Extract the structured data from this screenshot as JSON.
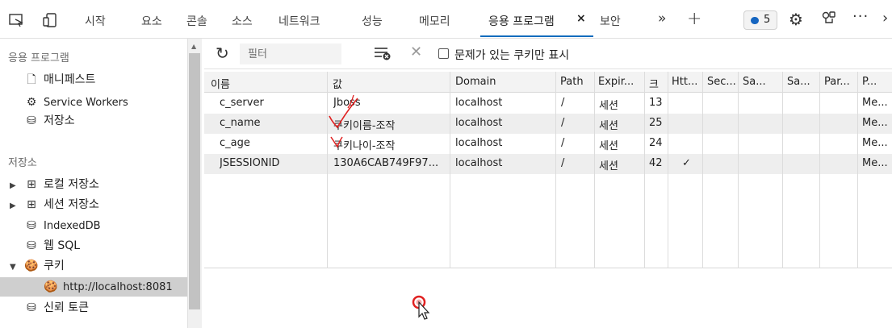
{
  "tabs": [
    {
      "label": "시작"
    },
    {
      "label": "요소"
    },
    {
      "label": "콘솔"
    },
    {
      "label": "소스"
    },
    {
      "label": "네트워크"
    },
    {
      "label": "성능"
    },
    {
      "label": "메모리"
    },
    {
      "label": "응용 프로그램"
    },
    {
      "label": "보안"
    }
  ],
  "topbar": {
    "active_tab_close": "×",
    "more_tabs": "»",
    "add_tab": "+",
    "issues_count": "5",
    "issues_color": "#1565c0",
    "settings_icon": "gear-icon",
    "connect_icon": "device-link-icon",
    "more_icon": "···",
    "chevron": "›"
  },
  "sidebar": {
    "app_heading": "응용 프로그램",
    "app_items": [
      {
        "icon": "manifest-icon",
        "label": "매니페스트"
      },
      {
        "icon": "gear-icon",
        "label": "Service Workers"
      },
      {
        "icon": "storage-icon",
        "label": "저장소"
      }
    ],
    "storage_heading": "저장소",
    "storage_items": [
      {
        "icon": "grid-icon",
        "label": "로컬 저장소"
      },
      {
        "icon": "grid-icon",
        "label": "세션 저장소"
      },
      {
        "icon": "database-icon",
        "label": "IndexedDB"
      },
      {
        "icon": "database-icon",
        "label": "웹 SQL"
      },
      {
        "icon": "cookie-icon",
        "label": "쿠키"
      },
      {
        "icon": "cookie-icon",
        "label": "http://localhost:8081"
      },
      {
        "icon": "database-icon",
        "label": "신뢰 토큰"
      }
    ]
  },
  "toolbar": {
    "filter_placeholder": "필터",
    "only_issues_label": "문제가 있는 쿠키만 표시"
  },
  "table": {
    "columns": [
      "이름",
      "값",
      "Domain",
      "Path",
      "Expir...",
      "크",
      "Htt...",
      "Sec...",
      "Sa...",
      "Sa...",
      "Par...",
      "P..."
    ],
    "rows": [
      {
        "name": "c_server",
        "value": "Jboss",
        "domain": "localhost",
        "path": "/",
        "expires": "세션",
        "size": "13",
        "httponly": "",
        "priority": "Me..."
      },
      {
        "name": "c_name",
        "value": "쿠키이름-조작",
        "domain": "localhost",
        "path": "/",
        "expires": "세션",
        "size": "25",
        "httponly": "",
        "priority": "Me..."
      },
      {
        "name": "c_age",
        "value": "쿠키나이-조작",
        "domain": "localhost",
        "path": "/",
        "expires": "세션",
        "size": "24",
        "httponly": "",
        "priority": "Me..."
      },
      {
        "name": "JSESSIONID",
        "value": "130A6CAB749F97...",
        "domain": "localhost",
        "path": "/",
        "expires": "세션",
        "size": "42",
        "httponly": "✓",
        "priority": "Me..."
      }
    ]
  },
  "colors": {
    "accent": "#0f6cbd",
    "annotation": "#e02020",
    "selected_bg": "#cfcfcf"
  }
}
